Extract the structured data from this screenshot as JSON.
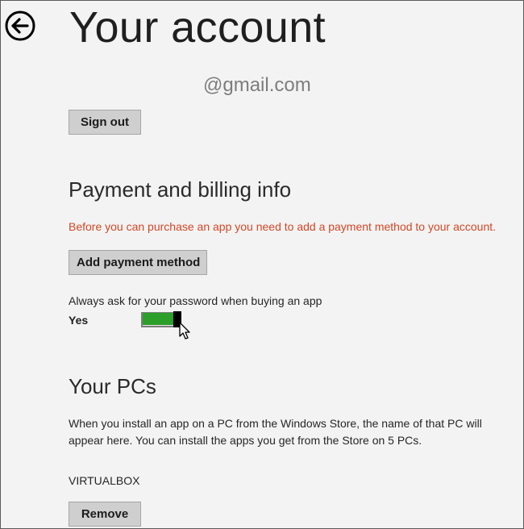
{
  "header": {
    "title": "Your account",
    "back_icon": "circle-arrow-left-icon"
  },
  "account": {
    "email": "@gmail.com",
    "sign_out_label": "Sign out"
  },
  "payment": {
    "heading": "Payment and billing info",
    "warning": "Before you can purchase an app you need to add a payment method to your account.",
    "add_payment_label": "Add payment method",
    "password_prompt_label": "Always ask for your password when buying an app",
    "password_prompt_state": "Yes",
    "password_prompt_enabled": true,
    "toggle_color": "#2c9f2a"
  },
  "pcs": {
    "heading": "Your PCs",
    "description": "When you install an app on a PC from the Windows Store, the name of that PC will appear here. You can install the apps you get from the Store on 5 PCs.",
    "items": [
      {
        "name": "VIRTUALBOX",
        "remove_label": "Remove"
      }
    ]
  },
  "colors": {
    "background": "#f3f3f3",
    "button": "#cfcfcf",
    "warning": "#d24726",
    "email": "#7d7d7d"
  }
}
